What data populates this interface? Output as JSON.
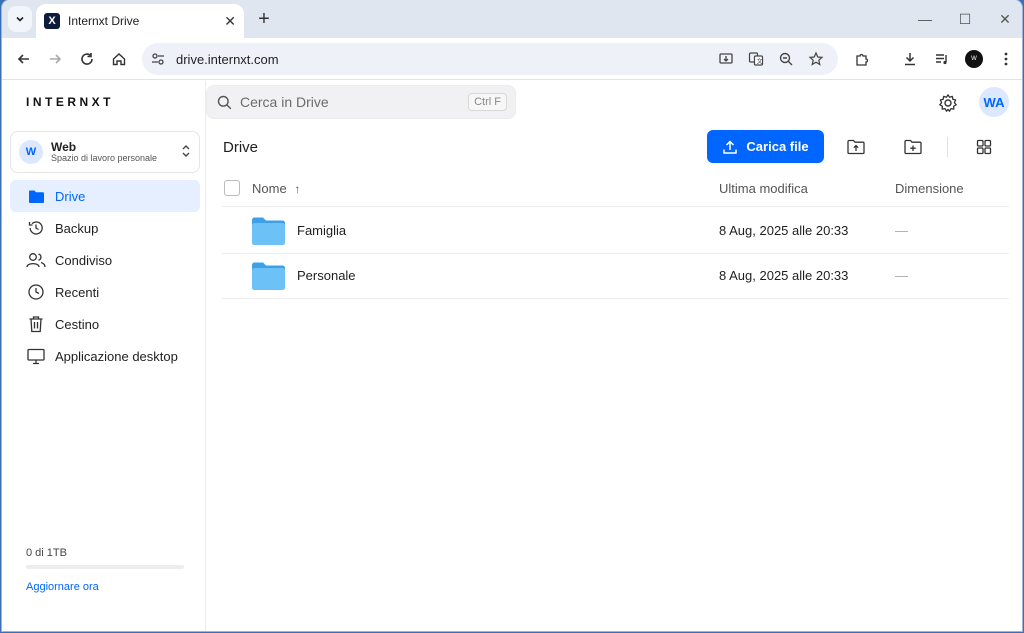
{
  "browser": {
    "tab_title": "Internxt Drive",
    "tab_favicon_letter": "X",
    "url": "drive.internxt.com",
    "profile_initials": "W"
  },
  "app": {
    "logo": "INTERNXT",
    "search": {
      "placeholder": "Cerca in Drive",
      "shortcut": "Ctrl F"
    },
    "user_initials": "WA",
    "workspace": {
      "avatar": "W",
      "name": "Web",
      "subtitle": "Spazio di lavoro personale"
    },
    "nav": [
      {
        "label": "Drive",
        "icon": "folder-icon",
        "active": true
      },
      {
        "label": "Backup",
        "icon": "history-icon",
        "active": false
      },
      {
        "label": "Condiviso",
        "icon": "users-icon",
        "active": false
      },
      {
        "label": "Recenti",
        "icon": "clock-icon",
        "active": false
      },
      {
        "label": "Cestino",
        "icon": "trash-icon",
        "active": false
      },
      {
        "label": "Applicazione desktop",
        "icon": "desktop-icon",
        "active": false
      }
    ],
    "storage": {
      "text": "0 di 1TB",
      "used_fraction": 0,
      "upgrade_label": "Aggiornare ora"
    }
  },
  "main": {
    "breadcrumb": "Drive",
    "upload_label": "Carica file",
    "columns": {
      "name": "Nome",
      "sort_indicator": "↑",
      "modified": "Ultima modifica",
      "size": "Dimensione"
    },
    "rows": [
      {
        "name": "Famiglia",
        "modified": "8 Aug, 2025 alle 20:33",
        "size": "—"
      },
      {
        "name": "Personale",
        "modified": "8 Aug, 2025 alle 20:33",
        "size": "—"
      }
    ]
  },
  "colors": {
    "accent": "#0066ff",
    "folder": "#5eb7f5",
    "active_bg": "#e6efff"
  }
}
